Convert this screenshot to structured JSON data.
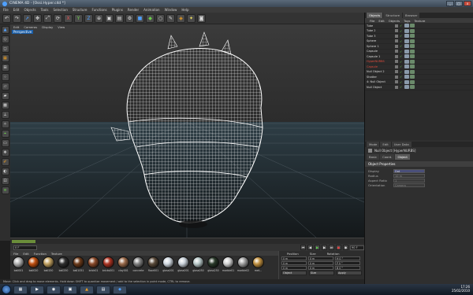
{
  "window": {
    "title": "CINEMA 4D - [Ossi.Hyper.c4d *]",
    "controls": [
      "_",
      "□",
      "x"
    ]
  },
  "menubar": [
    "File",
    "Edit",
    "Objects",
    "Tools",
    "Selection",
    "Structure",
    "Functions",
    "Plugins",
    "Render",
    "Animation",
    "Window",
    "Help"
  ],
  "toolbar": {
    "icons": [
      "undo-icon",
      "redo-icon",
      "live-select-icon",
      "move-icon",
      "scale-icon",
      "rotate-icon",
      "axis-x-icon",
      "axis-y-icon",
      "axis-z-icon",
      "world-icon",
      "render-view-icon",
      "render-picture-icon",
      "render-settings-icon",
      "cube-icon",
      "hypernurbs-icon",
      "null-icon",
      "pen-icon",
      "deformer-icon",
      "light-icon",
      "camera-icon"
    ]
  },
  "viewport": {
    "menu": [
      "Edit",
      "Cameras",
      "Display",
      "View"
    ],
    "label": "Perspective"
  },
  "transport": {
    "frame": "0 F",
    "end_frame": "90 F"
  },
  "materials": {
    "menu": [
      "File",
      "Edit",
      "Function",
      "Texture"
    ],
    "items": [
      {
        "name": "ball001",
        "color": "#b0b0b0"
      },
      {
        "name": "ball020",
        "color": "#c05010"
      },
      {
        "name": "ball150",
        "color": "#c0a060"
      },
      {
        "name": "ball250",
        "color": "#303030"
      },
      {
        "name": "ball1051",
        "color": "#6b3a1a"
      },
      {
        "name": "brick01",
        "color": "#8a4a2a"
      },
      {
        "name": "bricks001",
        "color": "#aa3322"
      },
      {
        "name": "clay001",
        "color": "#9a6a4a"
      },
      {
        "name": "concrete",
        "color": "#808080"
      },
      {
        "name": "floor001",
        "color": "#5a4a3a"
      },
      {
        "name": "glass001",
        "color": "#d0d8e0"
      },
      {
        "name": "glass001",
        "color": "#c8d0d8"
      },
      {
        "name": "glass050",
        "color": "#b8c8c8"
      },
      {
        "name": "glass250",
        "color": "#2a3a2a"
      },
      {
        "name": "marble01",
        "color": "#d0d0d0"
      },
      {
        "name": "marble02",
        "color": "#a0a0a0"
      },
      {
        "name": "met...",
        "color": "#c09040"
      }
    ]
  },
  "coords": {
    "headers": [
      "Position",
      "Size",
      "Rotation"
    ],
    "rows": [
      [
        "0 m",
        "0 m",
        "H 0 °"
      ],
      [
        "0 m",
        "0 m",
        "P 0 °"
      ],
      [
        "0 m",
        "0 m",
        "B 0 °"
      ]
    ],
    "mode": "Object",
    "size_mode": "Size",
    "apply": "Apply"
  },
  "status": "Move: Click and drag to move elements. Hold down SHIFT to quantize movement / add to the selection in point mode, CTRL to remove.",
  "objects_panel": {
    "tabs": [
      "Objects",
      "Structure",
      "Browser"
    ],
    "menu": [
      "File",
      "Edit",
      "Objects",
      "Tags",
      "Texture"
    ],
    "items": [
      {
        "name": "Tube",
        "red": false
      },
      {
        "name": "Tube 2",
        "red": false
      },
      {
        "name": "Tube 3",
        "red": false
      },
      {
        "name": "Sphere",
        "red": false
      },
      {
        "name": "Sphere 1",
        "red": false
      },
      {
        "name": "Capsule",
        "red": false
      },
      {
        "name": "Capsule 1",
        "red": false
      },
      {
        "name": "HyperNURBS",
        "red": true
      },
      {
        "name": "Capsule",
        "red": true
      },
      {
        "name": "Null Object 2",
        "red": false
      },
      {
        "name": "Shatter",
        "red": false
      },
      {
        "name": "4: Null Object",
        "red": false
      },
      {
        "name": "Null Object",
        "red": false
      }
    ]
  },
  "attributes": {
    "menu": [
      "Mode",
      "Edit",
      "User Data"
    ],
    "title": "Null Object [HyperNURBS]",
    "tabs": [
      "Basic",
      "Coord.",
      "Object"
    ],
    "section": "Object Properties",
    "rows": [
      {
        "label": "Display",
        "value": "Dot",
        "active": true
      },
      {
        "label": "Radius",
        "value": "10 m",
        "active": false
      },
      {
        "label": "Aspect Ratio",
        "value": "1",
        "active": false
      },
      {
        "label": "Orientation",
        "value": "Camera",
        "active": false
      }
    ]
  },
  "taskbar": {
    "time": "17:26",
    "date": "25/02/2010"
  }
}
